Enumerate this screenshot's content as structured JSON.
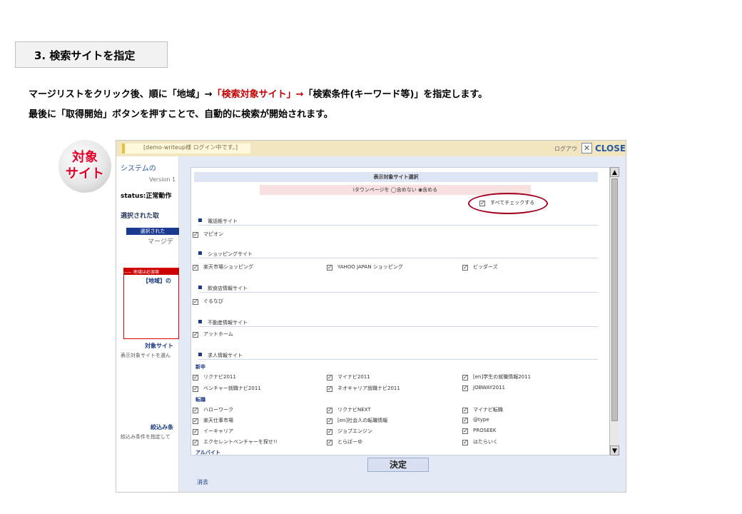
{
  "step_heading": "3. 検索サイトを指定",
  "intro": {
    "line1_a": "マージリストをクリック後、順に「地域」→",
    "line1_b": "「検索対象サイト」→",
    "line1_c": "「検索条件(キーワード等)」を指定します。",
    "line2": "最後に「取得開始」ボタンを押すことで、自動的に検索が開始されます。"
  },
  "badge": {
    "line1": "対象",
    "line2": "サイト"
  },
  "app": {
    "login_text": "[demo-writeup様 ログイン中です。]",
    "help_label": "ログアウ",
    "close_label": "CLOSE",
    "background": {
      "system": "システムの",
      "version": "Version 1",
      "status": "status:正常動作",
      "selected": "選択された取",
      "selected2": "選択された",
      "merge": "マージデ",
      "region_note": "----- 地域は必須項",
      "region_label": "【地域】の",
      "target_site": "対象サイト",
      "target_hint": "表示対象サイトを選ん",
      "refine": "絞込み条",
      "refine_hint": "絞込み条件を指定して",
      "clear": "消去"
    }
  },
  "dialog": {
    "title": "表示対象サイト選択",
    "include_label": "iタウンページを",
    "include_opt1": "含めない",
    "include_opt2": "含める",
    "check_all": "すべてチェックする",
    "categories": [
      {
        "name": "電話帳サイト"
      },
      {
        "name": "ショッピングサイト"
      },
      {
        "name": "飲食店情報サイト"
      },
      {
        "name": "不動産情報サイト"
      },
      {
        "name": "求人情報サイト"
      }
    ],
    "phone": [
      "マピオン"
    ],
    "shopping": [
      "楽天市場ショッピング",
      "YAHOO JAPAN ショッピング",
      "ビッダーズ"
    ],
    "food": [
      "ぐるなび"
    ],
    "estate": [
      "アットホーム"
    ],
    "sub_new": "新卒",
    "jobs_new": [
      "リクナビ2011",
      "マイナビ2011",
      "[en]学生の就職情報2011",
      "ベンチャー就職ナビ2011",
      "ネオキャリア就職ナビ2011",
      "JOBWAY2011"
    ],
    "sub_change": "転職",
    "jobs_change": [
      "ハローワーク",
      "リクナビNEXT",
      "マイナビ転職",
      "楽天仕事市場",
      "[en]社会人の転職情報",
      "@type",
      "イーキャリア",
      "ジョブエンジン",
      "PROSEEK",
      "エクセレントベンチャーを探せ!!",
      "とらばーゆ",
      "はたらいく"
    ],
    "sub_part": "アルバイト",
    "ok_label": "決定"
  }
}
